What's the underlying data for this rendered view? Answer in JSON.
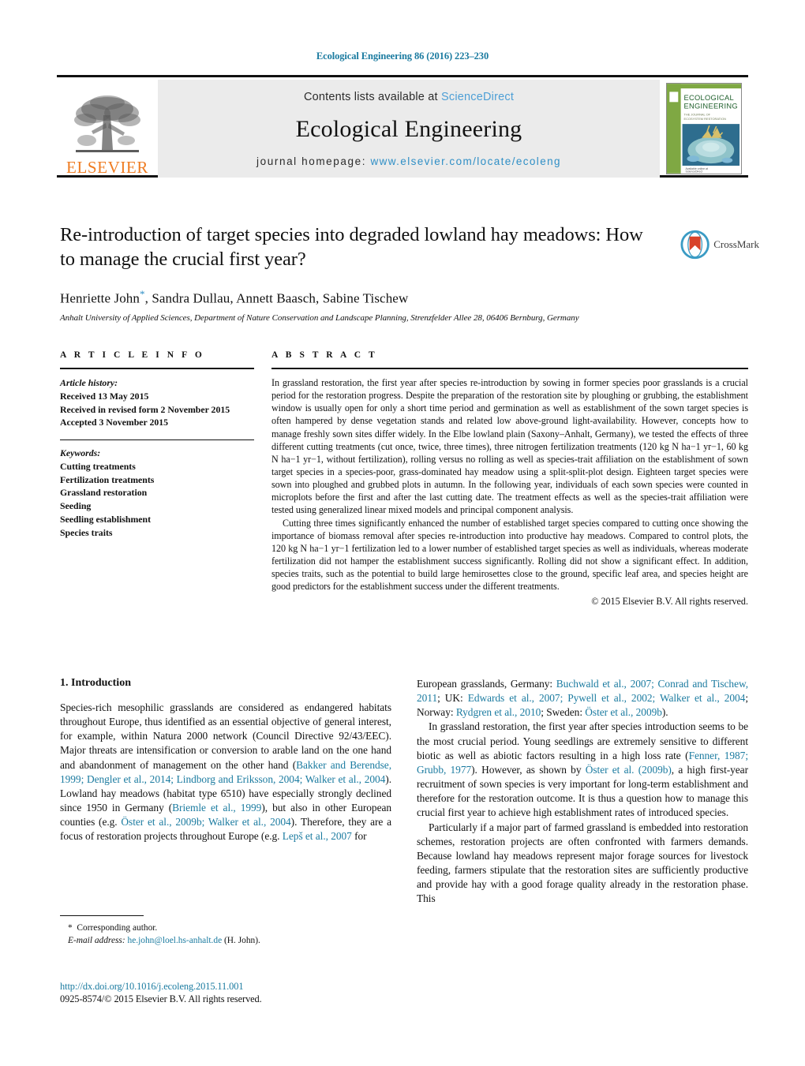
{
  "running_head": "Ecological Engineering 86 (2016) 223–230",
  "masthead": {
    "contents_prefix": "Contents lists available at ",
    "sciencedirect": "ScienceDirect",
    "journal_title": "Ecological Engineering",
    "homepage_prefix": "journal homepage:",
    "homepage_url": "www.elsevier.com/locate/ecoleng",
    "publisher_wordmark": "ELSEVIER",
    "cover_title_line1": "ECOLOGICAL",
    "cover_title_line2": "ENGINEERING",
    "colors": {
      "link_teal": "#1b7ba0",
      "link_blue": "#2f8fc6",
      "sciencedirect_blue": "#4d9fd6",
      "elsevier_orange": "#ef7c22",
      "band_gray": "#ebebeb"
    }
  },
  "article": {
    "title": "Re-introduction of target species into degraded lowland hay meadows: How to manage the crucial first year?",
    "authors": "Henriette John",
    "corresponding_marker": "*",
    "authors_rest": ", Sandra Dullau, Annett Baasch, Sabine Tischew",
    "affiliation": "Anhalt University of Applied Sciences, Department of Nature Conservation and Landscape Planning, Strenzfelder Allee 28, 06406 Bernburg, Germany",
    "crossmark_label": "CrossMark"
  },
  "article_info": {
    "heading": "A R T I C L E  I N F O",
    "history_label": "Article history:",
    "history": [
      "Received 13 May 2015",
      "Received in revised form 2 November 2015",
      "Accepted 3 November 2015"
    ],
    "keywords_label": "Keywords:",
    "keywords": [
      "Cutting treatments",
      "Fertilization treatments",
      "Grassland restoration",
      "Seeding",
      "Seedling establishment",
      "Species traits"
    ]
  },
  "abstract": {
    "heading": "A B S T R A C T",
    "paragraph1": "In grassland restoration, the first year after species re-introduction by sowing in former species poor grasslands is a crucial period for the restoration progress. Despite the preparation of the restoration site by ploughing or grubbing, the establishment window is usually open for only a short time period and germination as well as establishment of the sown target species is often hampered by dense vegetation stands and related low above-ground light-availability. However, concepts how to manage freshly sown sites differ widely. In the Elbe lowland plain (Saxony–Anhalt, Germany), we tested the effects of three different cutting treatments (cut once, twice, three times), three nitrogen fertilization treatments (120 kg N ha−1 yr−1, 60 kg N ha−1 yr−1, without fertilization), rolling versus no rolling as well as species-trait affiliation on the establishment of sown target species in a species-poor, grass-dominated hay meadow using a split-split-plot design. Eighteen target species were sown into ploughed and grubbed plots in autumn. In the following year, individuals of each sown species were counted in microplots before the first and after the last cutting date. The treatment effects as well as the species-trait affiliation were tested using generalized linear mixed models and principal component analysis.",
    "paragraph2": "Cutting three times significantly enhanced the number of established target species compared to cutting once showing the importance of biomass removal after species re-introduction into productive hay meadows. Compared to control plots, the 120 kg N ha−1 yr−1 fertilization led to a lower number of established target species as well as individuals, whereas moderate fertilization did not hamper the establishment success significantly. Rolling did not show a significant effect. In addition, species traits, such as the potential to build large hemirosettes close to the ground, specific leaf area, and species height are good predictors for the establishment success under the different treatments.",
    "copyright": "© 2015 Elsevier B.V. All rights reserved."
  },
  "introduction": {
    "heading": "1.  Introduction",
    "left_p1": "Species-rich mesophilic grasslands are considered as endangered habitats throughout Europe, thus identified as an essential objective of general interest, for example, within Natura 2000 network (Council Directive 92/43/EEC). Major threats are intensification or conversion to arable land on the one hand and abandonment of management on the other hand (",
    "left_p1_ref1": "Bakker and Berendse, 1999; Dengler et al., 2014; Lindborg and Eriksson, 2004; Walker et al., 2004",
    "left_p1_b": "). Lowland hay meadows (habitat type 6510) have especially strongly declined since 1950 in Germany (",
    "left_p1_ref2": "Briemle et al., 1999",
    "left_p1_c": "), but also in other European counties (e.g. ",
    "left_p1_ref3": "Öster et al., 2009b; Walker et al., 2004",
    "left_p1_d": "). Therefore, they are a focus of restoration projects throughout Europe (e.g. ",
    "left_p1_ref4": "Lepš et al., 2007",
    "left_p1_e": " for",
    "right_p0_a": "European grasslands, Germany: ",
    "right_p0_ref1": "Buchwald et al., 2007; Conrad and Tischew, 2011",
    "right_p0_b": "; UK: ",
    "right_p0_ref2": "Edwards et al., 2007; Pywell et al., 2002; Walker et al., 2004",
    "right_p0_c": "; Norway: ",
    "right_p0_ref3": "Rydgren et al., 2010",
    "right_p0_d": "; Sweden: ",
    "right_p0_ref4": "Öster et al., 2009b",
    "right_p0_e": ").",
    "right_p1_a": "In grassland restoration, the first year after species introduction seems to be the most crucial period. Young seedlings are extremely sensitive to different biotic as well as abiotic factors resulting in a high loss rate (",
    "right_p1_ref1": "Fenner, 1987; Grubb, 1977",
    "right_p1_b": "). However, as shown by ",
    "right_p1_ref2": "Öster et al. (2009b)",
    "right_p1_c": ", a high first-year recruitment of sown species is very important for long-term establishment and therefore for the restoration outcome. It is thus a question how to manage this crucial first year to achieve high establishment rates of introduced species.",
    "right_p2": "Particularly if a major part of farmed grassland is embedded into restoration schemes, restoration projects are often confronted with farmers demands. Because lowland hay meadows represent major forage sources for livestock feeding, farmers stipulate that the restoration sites are sufficiently productive and provide hay with a good forage quality already in the restoration phase. This"
  },
  "footer": {
    "corresponding_marker": "*",
    "corresponding_text": "Corresponding author.",
    "email_label": "E-mail address:",
    "email": "he.john@loel.hs-anhalt.de",
    "email_suffix": "(H. John).",
    "doi": "http://dx.doi.org/10.1016/j.ecoleng.2015.11.001",
    "issn": "0925-8574/© 2015 Elsevier B.V. All rights reserved."
  }
}
